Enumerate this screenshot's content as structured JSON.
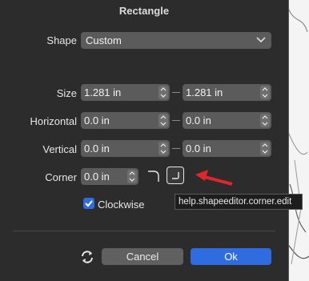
{
  "dialog": {
    "title": "Rectangle",
    "shape": {
      "label": "Shape",
      "value": "Custom"
    },
    "size": {
      "label": "Size",
      "width": "1.281 in",
      "height": "1.281 in"
    },
    "horizontal": {
      "label": "Horizontal",
      "value1": "0.0 in",
      "value2": "0.0 in"
    },
    "vertical": {
      "label": "Vertical",
      "value1": "0.0 in",
      "value2": "0.0 in"
    },
    "corner": {
      "label": "Corner",
      "value": "0.0 in"
    },
    "clockwise": {
      "label": "Clockwise",
      "checked": true
    },
    "buttons": {
      "cancel": "Cancel",
      "ok": "Ok"
    }
  },
  "tooltip": {
    "text": "help.shapeeditor.corner.edit"
  },
  "colors": {
    "accent": "#2f6cdf",
    "annotation_arrow": "#e0262d",
    "dialog_bg": "#2c2c2c"
  }
}
